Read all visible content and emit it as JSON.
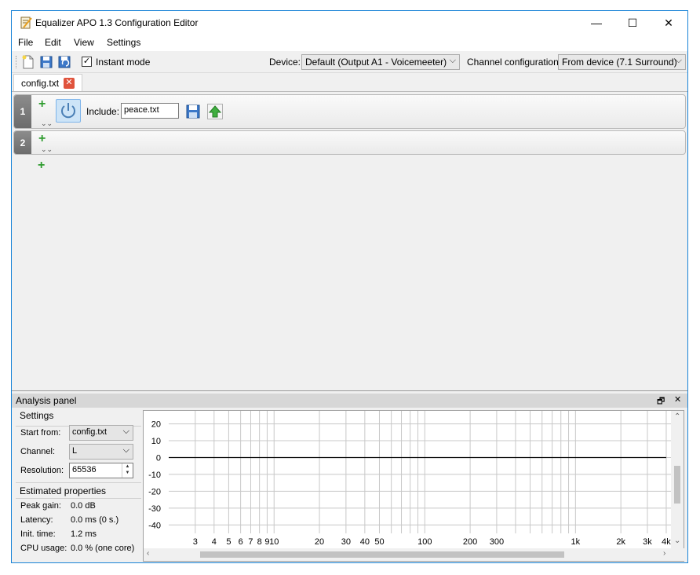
{
  "window": {
    "title": "Equalizer APO 1.3 Configuration Editor",
    "minimize": "—",
    "maximize": "☐",
    "close": "✕"
  },
  "menu": [
    "File",
    "Edit",
    "View",
    "Settings"
  ],
  "toolbar": {
    "instant_mode_label": "Instant mode",
    "instant_mode_checked": "✓",
    "device_label": "Device:",
    "device_value": "Default (Output A1 - Voicemeeter)",
    "channel_config_label": "Channel configuration:",
    "channel_config_value": "From device (7.1 Surround)"
  },
  "tabs": [
    {
      "label": "config.txt",
      "close": "✕"
    }
  ],
  "editor": {
    "rows": [
      {
        "number": "1",
        "include_label": "Include:",
        "include_value": "peace.txt"
      },
      {
        "number": "2"
      }
    ],
    "plus": "+",
    "chevron": "⌄⌄"
  },
  "analysis": {
    "title": "Analysis panel",
    "restore": "🗗",
    "close": "✕",
    "settings_title": "Settings",
    "start_from_label": "Start from:",
    "start_from_value": "config.txt",
    "channel_label": "Channel:",
    "channel_value": "L",
    "resolution_label": "Resolution:",
    "resolution_value": "65536",
    "estimated_title": "Estimated properties",
    "props": [
      {
        "label": "Peak gain:",
        "value": "0.0 dB"
      },
      {
        "label": "Latency:",
        "value": "0.0 ms (0 s.)"
      },
      {
        "label": "Init. time:",
        "value": "1.2 ms"
      },
      {
        "label": "CPU usage:",
        "value": "0.0 % (one core)"
      }
    ]
  },
  "chart_data": {
    "type": "line",
    "title": "",
    "xlabel": "",
    "ylabel": "",
    "x_scale": "log",
    "y_ticks": [
      20,
      10,
      0,
      -10,
      -20,
      -30,
      -40
    ],
    "x_tick_labels": [
      {
        "value": 3,
        "label": "3"
      },
      {
        "value": 4,
        "label": "4"
      },
      {
        "value": 5,
        "label": "5"
      },
      {
        "value": 6,
        "label": "6"
      },
      {
        "value": 7,
        "label": "7"
      },
      {
        "value": 8,
        "label": "8"
      },
      {
        "value": 9,
        "label": "9"
      },
      {
        "value": 10,
        "label": "10"
      },
      {
        "value": 20,
        "label": "20"
      },
      {
        "value": 30,
        "label": "30"
      },
      {
        "value": 40,
        "label": "40"
      },
      {
        "value": 50,
        "label": "50"
      },
      {
        "value": 100,
        "label": "100"
      },
      {
        "value": 200,
        "label": "200"
      },
      {
        "value": 300,
        "label": "300"
      },
      {
        "value": 1000,
        "label": "1k"
      },
      {
        "value": 2000,
        "label": "2k"
      },
      {
        "value": 3000,
        "label": "3k"
      },
      {
        "value": 4000,
        "label": "4k"
      }
    ],
    "x_grid_values": [
      3,
      4,
      5,
      6,
      7,
      8,
      9,
      10,
      20,
      30,
      40,
      50,
      60,
      70,
      80,
      90,
      100,
      200,
      300,
      400,
      500,
      600,
      700,
      800,
      900,
      1000,
      2000,
      3000,
      4000
    ],
    "series": [
      {
        "x": [
          2,
          4000
        ],
        "y": [
          0,
          0
        ],
        "color": "#000000"
      }
    ],
    "ylim": [
      -45,
      24
    ],
    "grid": true
  },
  "colors": {
    "accent": "#1883d7",
    "plus": "#2d9b2d",
    "tab_close": "#e0533c"
  }
}
